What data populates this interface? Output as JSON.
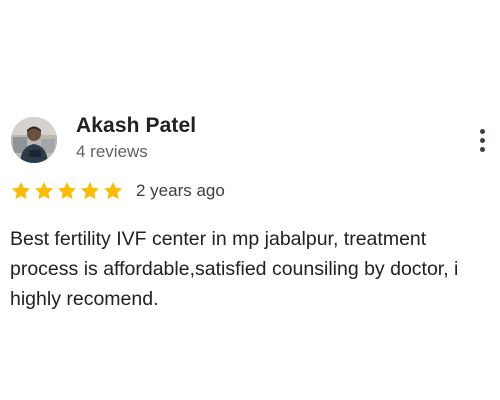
{
  "review": {
    "author_name": "Akash Patel",
    "author_reviews": "4 reviews",
    "rating": 5,
    "rating_max": 5,
    "date": "2 years ago",
    "text": "Best fertility IVF center in mp jabalpur, treatment process is affordable,satisfied counsiling by doctor, i highly recomend."
  },
  "icons": {
    "avatar": "avatar-photo",
    "more": "more-vert-icon",
    "star": "star-icon"
  },
  "colors": {
    "star": "#fbbc04",
    "name": "#202124",
    "meta": "#5f6368",
    "body_text": "#202124"
  }
}
